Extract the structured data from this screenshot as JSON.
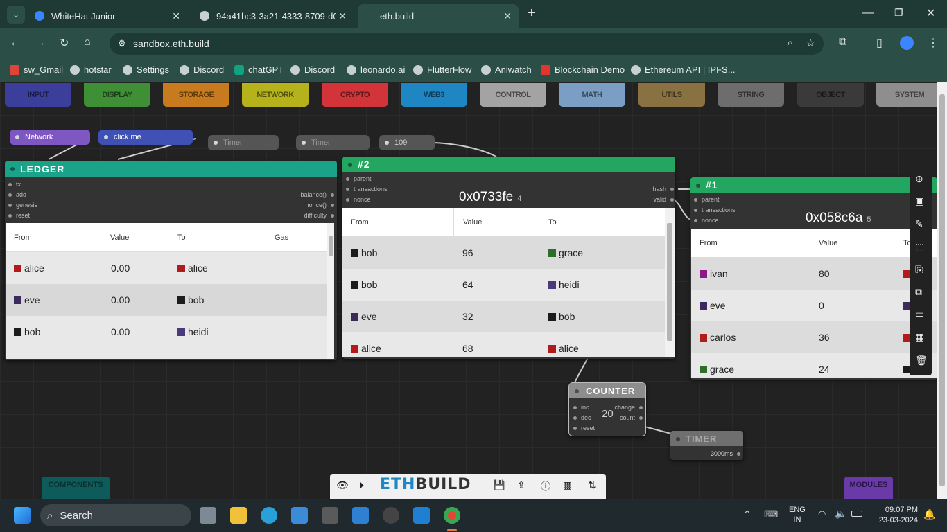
{
  "browser": {
    "tabs": [
      {
        "title": "WhiteHat Junior"
      },
      {
        "title": "94a41bc3-3a21-4333-8709-d0f"
      },
      {
        "title": "eth.build"
      }
    ],
    "new_tab": "+",
    "url": "sandbox.eth.build",
    "bookmarks": [
      "sw_Gmail",
      "hotstar",
      "Settings",
      "Discord",
      "chatGPT",
      "Discord",
      "leonardo.ai",
      "FlutterFlow",
      "Aniwatch",
      "Blockchain Demo",
      "Ethereum API | IPFS..."
    ]
  },
  "categories": [
    {
      "label": "INPUT",
      "color": "#3b3f9b"
    },
    {
      "label": "DISPLAY",
      "color": "#3f8f37"
    },
    {
      "label": "STORAGE",
      "color": "#c77b1e"
    },
    {
      "label": "NETWORK",
      "color": "#b6b21b"
    },
    {
      "label": "CRYPTO",
      "color": "#d2343a"
    },
    {
      "label": "WEB3",
      "color": "#1f86c4"
    },
    {
      "label": "CONTROL",
      "color": "#a3a3a3"
    },
    {
      "label": "MATH",
      "color": "#7b9fc4"
    },
    {
      "label": "UTILS",
      "color": "#8a7142"
    },
    {
      "label": "STRING",
      "color": "#6d6d6d"
    },
    {
      "label": "OBJECT",
      "color": "#3a3a3a"
    },
    {
      "label": "SYSTEM",
      "color": "#8e8e8e"
    }
  ],
  "chips": {
    "network": "Network",
    "click_me": "click me",
    "timer1": "Timer",
    "timer2": "Timer",
    "value109": "109"
  },
  "ledger": {
    "title": "LEDGER",
    "inputs": [
      "tx",
      "add",
      "genesis",
      "reset"
    ],
    "outputs": [
      "balance()",
      "nonce()",
      "difficulty"
    ],
    "columns": [
      "From",
      "Value",
      "To",
      "Gas"
    ],
    "rows": [
      {
        "from": "alice",
        "value": "0.00",
        "to": "alice",
        "from_color": "#b01b1b",
        "to_color": "#b01b1b"
      },
      {
        "from": "eve",
        "value": "0.00",
        "to": "bob",
        "from_color": "#3d2a5c",
        "to_color": "#1c1c1c"
      },
      {
        "from": "bob",
        "value": "0.00",
        "to": "heidi",
        "from_color": "#1c1c1c",
        "to_color": "#4b3a7a"
      }
    ]
  },
  "block2": {
    "title": "#2",
    "inputs": [
      "parent",
      "transactions",
      "nonce"
    ],
    "outputs": [
      "hash",
      "valid"
    ],
    "hash": "0x0733fe",
    "hash_count": "4",
    "columns": [
      "From",
      "Value",
      "To"
    ],
    "rows": [
      {
        "from": "bob",
        "value": "96",
        "to": "grace",
        "from_color": "#1c1c1c",
        "to_color": "#2f6e2a"
      },
      {
        "from": "bob",
        "value": "64",
        "to": "heidi",
        "from_color": "#1c1c1c",
        "to_color": "#4b3a7a"
      },
      {
        "from": "eve",
        "value": "32",
        "to": "bob",
        "from_color": "#3d2a5c",
        "to_color": "#1c1c1c"
      },
      {
        "from": "alice",
        "value": "68",
        "to": "alice",
        "from_color": "#b01b1b",
        "to_color": "#b01b1b"
      }
    ]
  },
  "block1": {
    "title": "#1",
    "inputs": [
      "parent",
      "transactions",
      "nonce"
    ],
    "hash": "0x058c6a",
    "hash_count": "5",
    "columns": [
      "From",
      "Value",
      "To"
    ],
    "rows": [
      {
        "from": "ivan",
        "value": "80",
        "from_color": "#8b1a8b"
      },
      {
        "from": "eve",
        "value": "0",
        "from_color": "#3d2a5c"
      },
      {
        "from": "carlos",
        "value": "36",
        "from_color": "#b01b1b"
      },
      {
        "from": "grace",
        "value": "24",
        "from_color": "#2f6e2a"
      }
    ]
  },
  "counter": {
    "title": "COUNTER",
    "inputs": [
      "inc",
      "dec",
      "reset"
    ],
    "outputs": [
      "change",
      "count"
    ],
    "value": "20"
  },
  "timer_node": {
    "title": "TIMER",
    "value": "3000ms"
  },
  "bottom": {
    "components": "COMPONENTS",
    "modules": "MODULES",
    "logo_a": "ETH",
    "logo_b": "BUILD"
  },
  "taskbar": {
    "search": "Search",
    "lang1": "ENG",
    "lang2": "IN",
    "time": "09:07 PM",
    "date": "23-03-2024"
  }
}
